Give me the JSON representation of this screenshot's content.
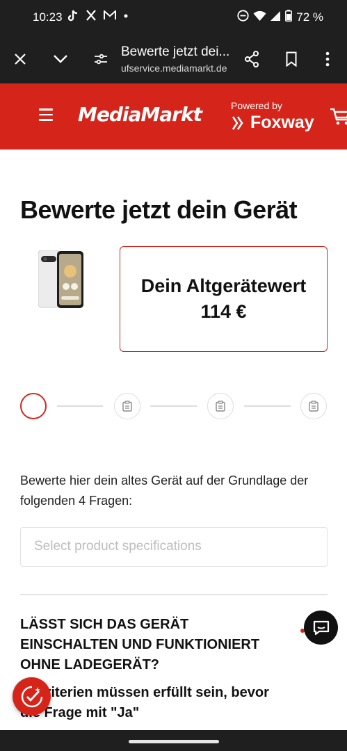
{
  "status_bar": {
    "time": "10:23",
    "battery": "72 %",
    "notification_icons": [
      "tiktok-icon",
      "x-icon",
      "gmail-icon",
      "dot-icon"
    ],
    "system_icons": [
      "dnd-icon",
      "wifi-icon",
      "signal-icon",
      "battery-icon"
    ]
  },
  "browser": {
    "page_title": "Bewerte jetzt dei...",
    "host": "ufservice.mediamarkt.de"
  },
  "header": {
    "brand": "MediaMarkt",
    "powered_by": "Powered by",
    "partner": "Foxway",
    "accent_color": "#d5251b"
  },
  "main": {
    "title": "Bewerte jetzt dein Gerät",
    "value_box": "Dein Altgerätewert 114 €",
    "steps_total": 4,
    "current_step": 1,
    "intro": "Bewerte hier dein altes Gerät auf der Grundlage der folgenden 4 Fragen:",
    "select_placeholder": "Select product specifications",
    "question": "LÄSST SICH DAS GERÄT EINSCHALTEN UND FUNKTIONIERT OHNE LADEGERÄT?",
    "criteria": "... Kriterien müssen erfüllt sein, bevor die Frage mit \"Ja\""
  }
}
